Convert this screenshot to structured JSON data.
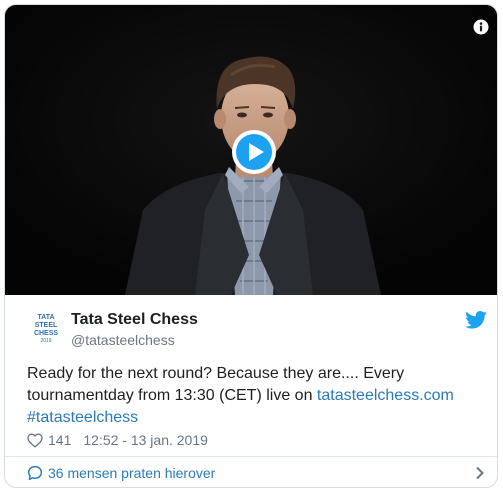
{
  "media": {
    "info_icon": "info-icon",
    "play_icon": "play-icon"
  },
  "author": {
    "name": "Tata Steel Chess",
    "handle": "@tatasteelchess",
    "avatar_lines": [
      "TATA",
      "STEEL",
      "CHESS",
      "2019"
    ],
    "platform_icon": "twitter-bird-icon"
  },
  "tweet": {
    "line1": "Ready for the next round? Because they are.... Every",
    "line2_text": "tournamentday from 13:30 (CET) live on ",
    "line2_link": "tatasteelchess.com",
    "hashtag": "#tatasteelchess"
  },
  "meta": {
    "likes": "141",
    "timestamp": "12:52 - 13 jan. 2019"
  },
  "footer": {
    "conversation": "36 mensen praten hierover"
  },
  "colors": {
    "link": "#2b7bb9",
    "text": "#1c2022",
    "secondary": "#697882",
    "play": "#1da1f2",
    "twitter": "#1da1f2",
    "avatar_blue": "#2f6db3"
  }
}
